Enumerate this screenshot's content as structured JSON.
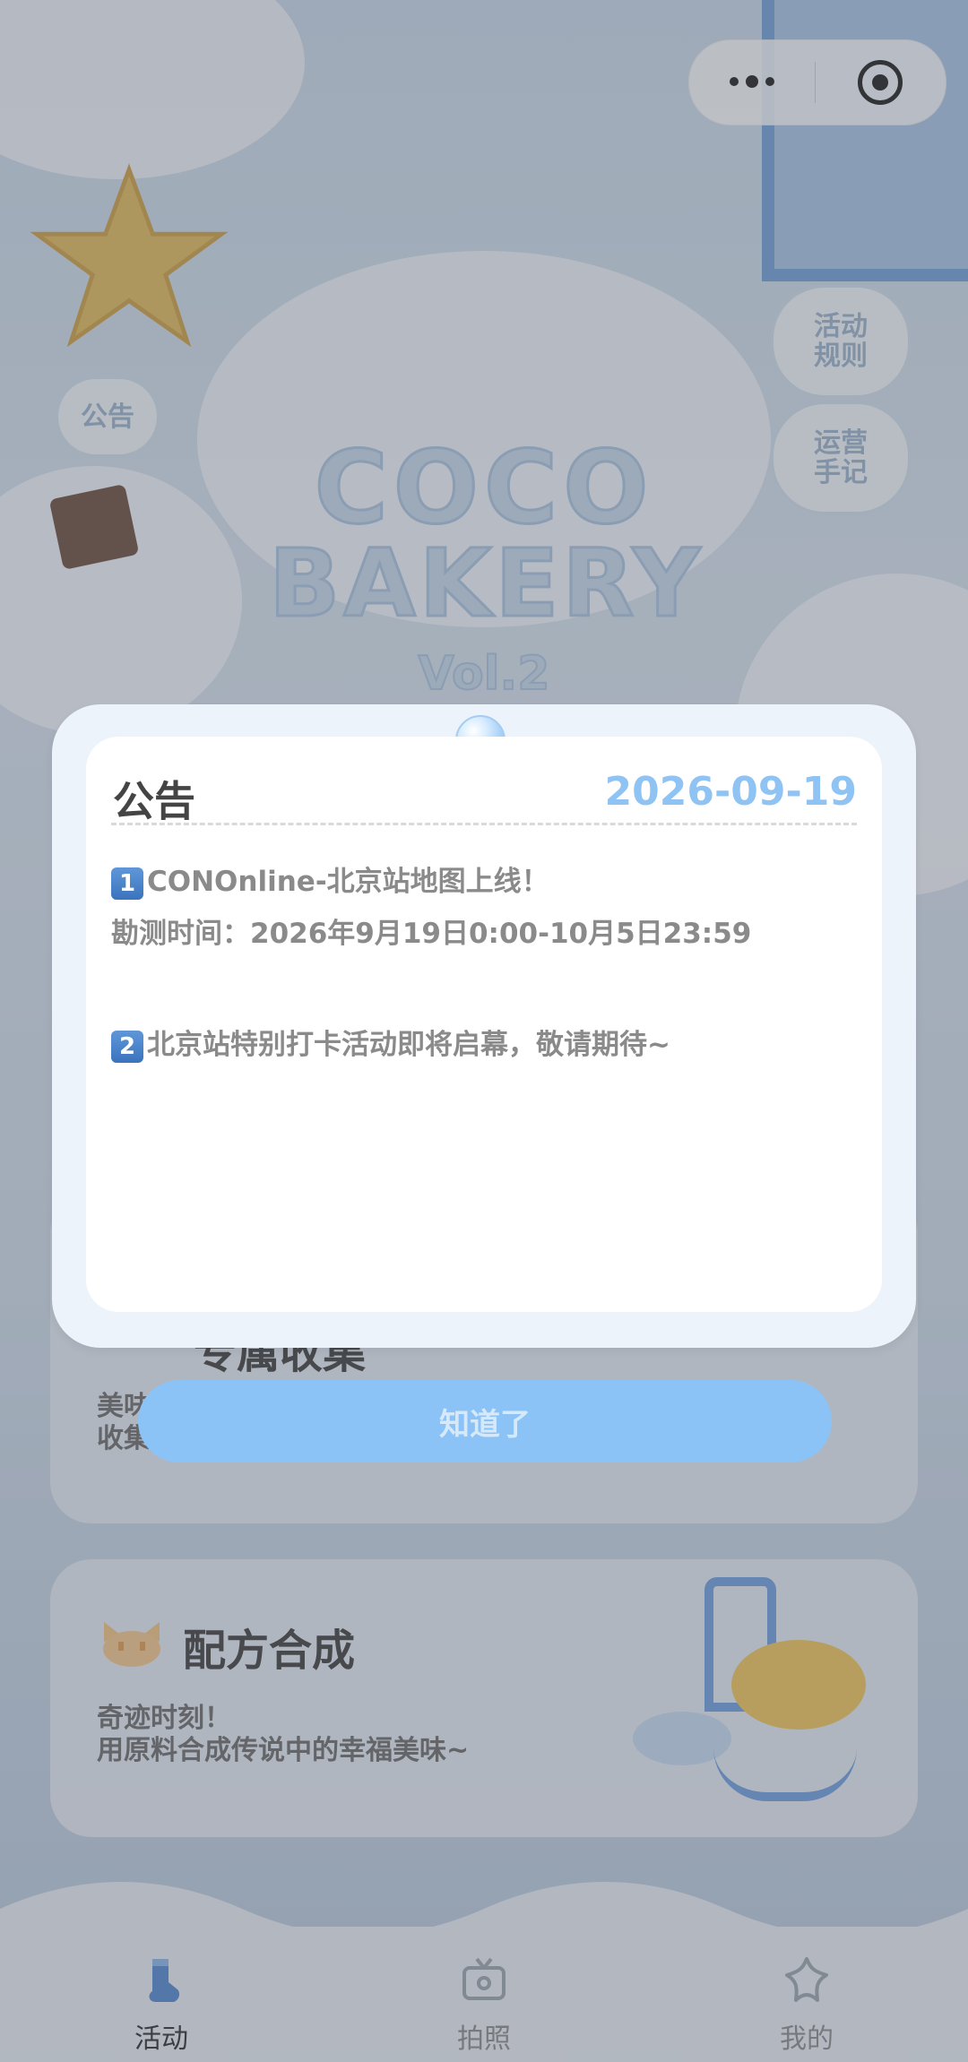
{
  "capsule": {
    "more_icon": "more-dots-icon",
    "close_icon": "target-close-icon"
  },
  "side_buttons": {
    "announcement": "公告",
    "activity_rules_line1": "活动",
    "activity_rules_line2": "规则",
    "ops_notes_line1": "运营",
    "ops_notes_line2": "手记"
  },
  "hero": {
    "line1": "COCO",
    "line2": "BAKERY",
    "vol": "Vol.2"
  },
  "cards": {
    "collect": {
      "title": "专属收集",
      "desc_line1": "美味",
      "desc_line2": "收集"
    },
    "recipe": {
      "title": "配方合成",
      "desc_line1": "奇迹时刻！",
      "desc_line2": "用原料合成传说中的幸福美味~"
    }
  },
  "modal": {
    "title": "公告",
    "date": "2026-09-19",
    "items": [
      {
        "num": "1",
        "text": "CONOnline-北京站地图上线！"
      },
      {
        "num": "",
        "text": "勘测时间：2026年9月19日0:00-10月5日23:59"
      },
      {
        "num": "2",
        "text": "北京站特别打卡活动即将启幕，敬请期待~"
      }
    ],
    "confirm": "知道了"
  },
  "tabbar": {
    "items": [
      {
        "label": "活动",
        "icon": "sock-icon",
        "active": true
      },
      {
        "label": "拍照",
        "icon": "tv-camera-icon",
        "active": false
      },
      {
        "label": "我的",
        "icon": "star-badge-icon",
        "active": false
      }
    ],
    "active_color": "#333333",
    "inactive_color": "#8a8a8a"
  },
  "colors": {
    "date_blue": "#8fc3f3",
    "button_blue": "#8cc3f6"
  }
}
